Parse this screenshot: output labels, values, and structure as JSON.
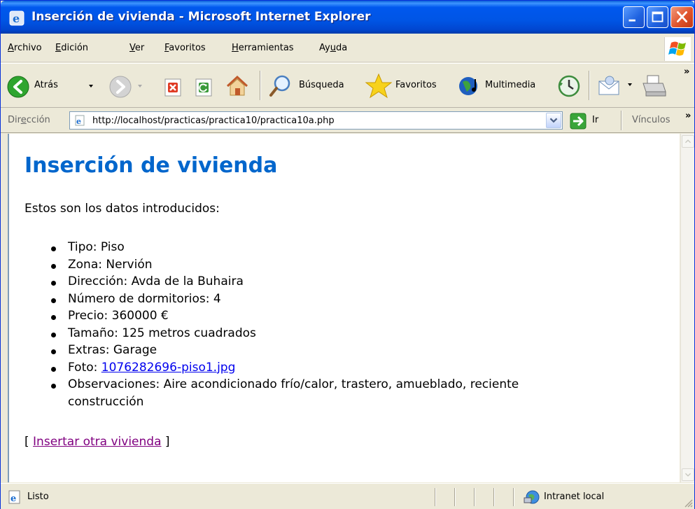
{
  "window": {
    "title": "Inserción de vivienda - Microsoft Internet Explorer"
  },
  "menu": {
    "items": [
      {
        "acc": "A",
        "rest": "rchivo"
      },
      {
        "acc": "E",
        "rest": "dición"
      },
      {
        "acc": "V",
        "rest": "er"
      },
      {
        "acc": "F",
        "rest": "avoritos"
      },
      {
        "acc": "H",
        "rest": "erramientas"
      },
      {
        "pre": "Ay",
        "acc": "u",
        "rest": "da"
      }
    ]
  },
  "toolbar": {
    "back_label": "Atrás",
    "search_label": "Búsqueda",
    "favorites_label": "Favoritos",
    "multimedia_label": "Multimedia"
  },
  "address": {
    "label_pre": "Dir",
    "label_acc": "e",
    "label_post": "cción",
    "url": "http://localhost/practicas/practica10/practica10a.php",
    "go_label": "Ir",
    "links_label": "Vínculos"
  },
  "page": {
    "heading": "Inserción de vivienda",
    "intro": "Estos son los datos introducidos:",
    "items": [
      {
        "label": "Tipo: Piso"
      },
      {
        "label": "Zona: Nervión"
      },
      {
        "label": "Dirección: Avda de la Buhaira"
      },
      {
        "label": "Número de dormitorios: 4"
      },
      {
        "label": "Precio: 360000 €"
      },
      {
        "label": "Tamaño: 125 metros cuadrados"
      },
      {
        "label": "Extras: Garage"
      }
    ],
    "photo_prefix": "Foto: ",
    "photo_link": "1076282696-piso1.jpg",
    "observations_line1": "Observaciones: Aire acondicionado frío/calor, trastero, amueblado, reciente",
    "observations_line2": "construcción",
    "back_open": "[ ",
    "back_link": "Insertar otra vivienda",
    "back_close": " ]"
  },
  "status": {
    "text": "Listo",
    "zone": "Intranet local"
  },
  "colors": {
    "title_bar": "#0055e5",
    "heading": "#0066cc",
    "link": "#0000ee",
    "visited_link": "#800080"
  }
}
